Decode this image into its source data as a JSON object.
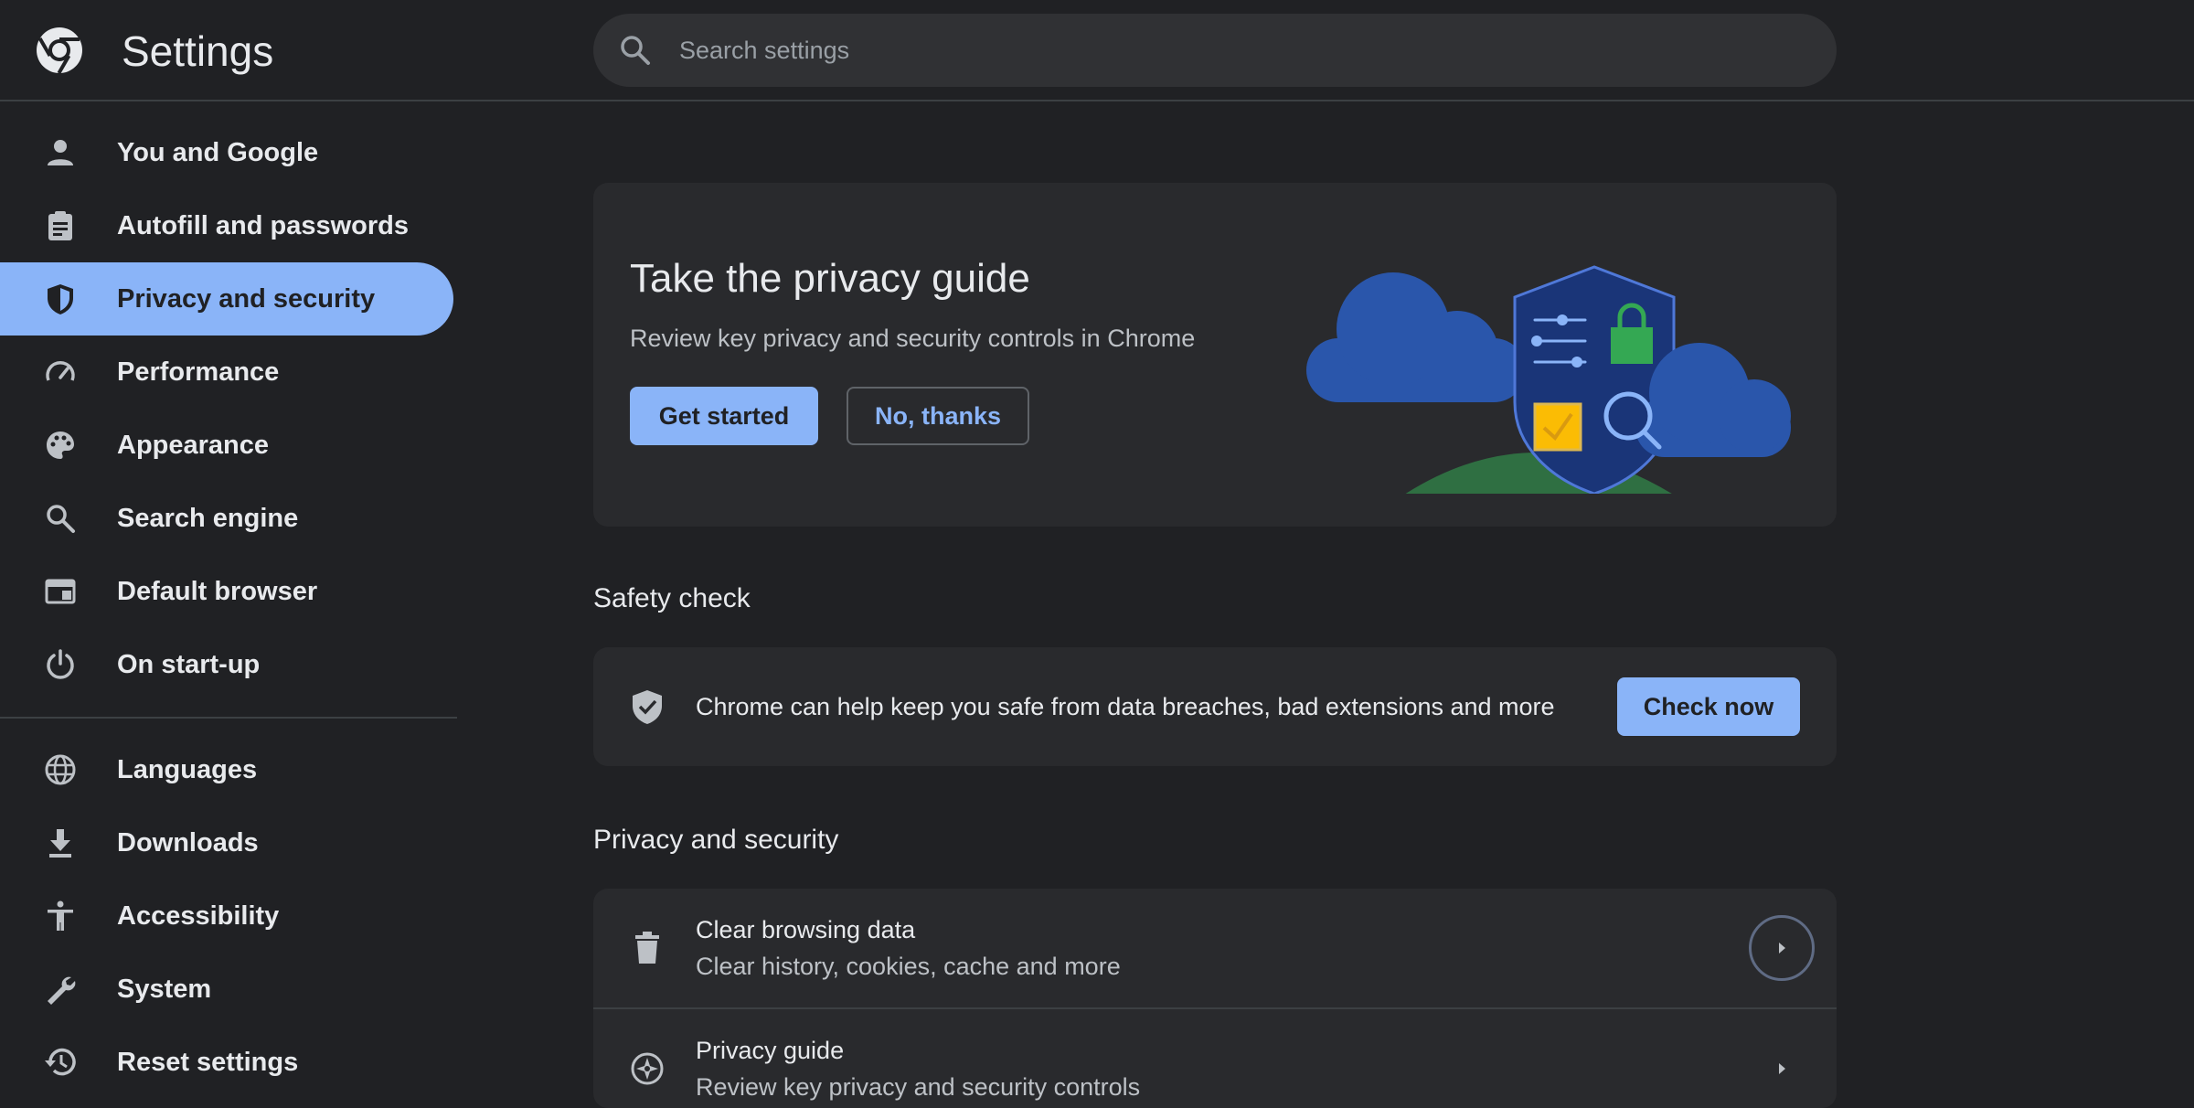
{
  "header": {
    "title": "Settings",
    "search_placeholder": "Search settings"
  },
  "sidebar": {
    "items": [
      {
        "label": "You and Google",
        "icon": "person-icon"
      },
      {
        "label": "Autofill and passwords",
        "icon": "clipboard-icon"
      },
      {
        "label": "Privacy and security",
        "icon": "shield-icon",
        "active": true
      },
      {
        "label": "Performance",
        "icon": "speedometer-icon"
      },
      {
        "label": "Appearance",
        "icon": "palette-icon"
      },
      {
        "label": "Search engine",
        "icon": "search-icon"
      },
      {
        "label": "Default browser",
        "icon": "browser-window-icon"
      },
      {
        "label": "On start-up",
        "icon": "power-icon"
      },
      {
        "label": "Languages",
        "icon": "globe-icon"
      },
      {
        "label": "Downloads",
        "icon": "download-icon"
      },
      {
        "label": "Accessibility",
        "icon": "accessibility-icon"
      },
      {
        "label": "System",
        "icon": "wrench-icon"
      },
      {
        "label": "Reset settings",
        "icon": "history-icon"
      }
    ]
  },
  "promo": {
    "title": "Take the privacy guide",
    "subtitle": "Review key privacy and security controls in Chrome",
    "primary_button": "Get started",
    "secondary_button": "No, thanks"
  },
  "safety_check": {
    "heading": "Safety check",
    "text": "Chrome can help keep you safe from data breaches, bad extensions and more",
    "button": "Check now"
  },
  "privacy_section": {
    "heading": "Privacy and security",
    "rows": [
      {
        "title": "Clear browsing data",
        "subtitle": "Clear history, cookies, cache and more",
        "icon": "trash-icon"
      },
      {
        "title": "Privacy guide",
        "subtitle": "Review key privacy and security controls",
        "icon": "compass-icon"
      }
    ]
  },
  "colors": {
    "background": "#202124",
    "card": "#292a2d",
    "accent": "#8ab4f8",
    "text": "#e8eaed",
    "secondary_text": "#bdc1c6"
  }
}
